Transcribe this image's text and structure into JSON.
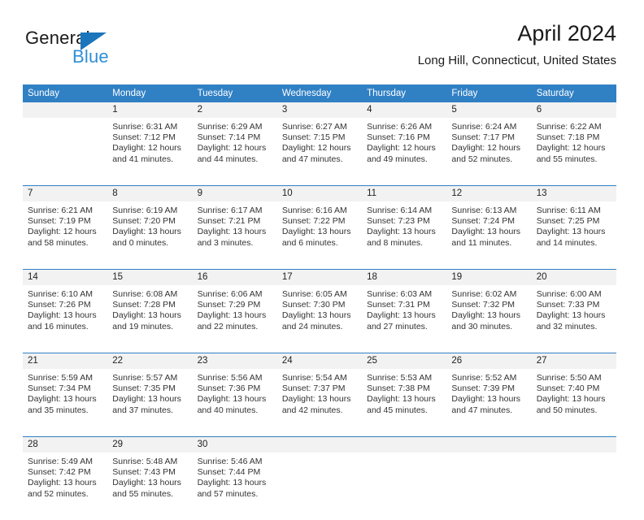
{
  "brand": {
    "name_top": "General",
    "name_bottom": "Blue",
    "triangle_color": "#1b75bb",
    "blue_color": "#2e8fd6"
  },
  "header": {
    "title": "April 2024",
    "location": "Long Hill, Connecticut, United States"
  },
  "theme": {
    "header_blue": "#3080c4",
    "daynum_band": "#f2f2f2",
    "text": "#333333"
  },
  "weekday_headers": [
    "Sunday",
    "Monday",
    "Tuesday",
    "Wednesday",
    "Thursday",
    "Friday",
    "Saturday"
  ],
  "labels": {
    "sunrise_prefix": "Sunrise:",
    "sunset_prefix": "Sunset:",
    "daylight_prefix": "Daylight:"
  },
  "weeks": [
    {
      "days": [
        {
          "num": "",
          "sunrise": "",
          "sunset": "",
          "daylight_1": "",
          "daylight_2": ""
        },
        {
          "num": "1",
          "sunrise": "Sunrise: 6:31 AM",
          "sunset": "Sunset: 7:12 PM",
          "daylight_1": "Daylight: 12 hours",
          "daylight_2": "and 41 minutes."
        },
        {
          "num": "2",
          "sunrise": "Sunrise: 6:29 AM",
          "sunset": "Sunset: 7:14 PM",
          "daylight_1": "Daylight: 12 hours",
          "daylight_2": "and 44 minutes."
        },
        {
          "num": "3",
          "sunrise": "Sunrise: 6:27 AM",
          "sunset": "Sunset: 7:15 PM",
          "daylight_1": "Daylight: 12 hours",
          "daylight_2": "and 47 minutes."
        },
        {
          "num": "4",
          "sunrise": "Sunrise: 6:26 AM",
          "sunset": "Sunset: 7:16 PM",
          "daylight_1": "Daylight: 12 hours",
          "daylight_2": "and 49 minutes."
        },
        {
          "num": "5",
          "sunrise": "Sunrise: 6:24 AM",
          "sunset": "Sunset: 7:17 PM",
          "daylight_1": "Daylight: 12 hours",
          "daylight_2": "and 52 minutes."
        },
        {
          "num": "6",
          "sunrise": "Sunrise: 6:22 AM",
          "sunset": "Sunset: 7:18 PM",
          "daylight_1": "Daylight: 12 hours",
          "daylight_2": "and 55 minutes."
        }
      ]
    },
    {
      "days": [
        {
          "num": "7",
          "sunrise": "Sunrise: 6:21 AM",
          "sunset": "Sunset: 7:19 PM",
          "daylight_1": "Daylight: 12 hours",
          "daylight_2": "and 58 minutes."
        },
        {
          "num": "8",
          "sunrise": "Sunrise: 6:19 AM",
          "sunset": "Sunset: 7:20 PM",
          "daylight_1": "Daylight: 13 hours",
          "daylight_2": "and 0 minutes."
        },
        {
          "num": "9",
          "sunrise": "Sunrise: 6:17 AM",
          "sunset": "Sunset: 7:21 PM",
          "daylight_1": "Daylight: 13 hours",
          "daylight_2": "and 3 minutes."
        },
        {
          "num": "10",
          "sunrise": "Sunrise: 6:16 AM",
          "sunset": "Sunset: 7:22 PM",
          "daylight_1": "Daylight: 13 hours",
          "daylight_2": "and 6 minutes."
        },
        {
          "num": "11",
          "sunrise": "Sunrise: 6:14 AM",
          "sunset": "Sunset: 7:23 PM",
          "daylight_1": "Daylight: 13 hours",
          "daylight_2": "and 8 minutes."
        },
        {
          "num": "12",
          "sunrise": "Sunrise: 6:13 AM",
          "sunset": "Sunset: 7:24 PM",
          "daylight_1": "Daylight: 13 hours",
          "daylight_2": "and 11 minutes."
        },
        {
          "num": "13",
          "sunrise": "Sunrise: 6:11 AM",
          "sunset": "Sunset: 7:25 PM",
          "daylight_1": "Daylight: 13 hours",
          "daylight_2": "and 14 minutes."
        }
      ]
    },
    {
      "days": [
        {
          "num": "14",
          "sunrise": "Sunrise: 6:10 AM",
          "sunset": "Sunset: 7:26 PM",
          "daylight_1": "Daylight: 13 hours",
          "daylight_2": "and 16 minutes."
        },
        {
          "num": "15",
          "sunrise": "Sunrise: 6:08 AM",
          "sunset": "Sunset: 7:28 PM",
          "daylight_1": "Daylight: 13 hours",
          "daylight_2": "and 19 minutes."
        },
        {
          "num": "16",
          "sunrise": "Sunrise: 6:06 AM",
          "sunset": "Sunset: 7:29 PM",
          "daylight_1": "Daylight: 13 hours",
          "daylight_2": "and 22 minutes."
        },
        {
          "num": "17",
          "sunrise": "Sunrise: 6:05 AM",
          "sunset": "Sunset: 7:30 PM",
          "daylight_1": "Daylight: 13 hours",
          "daylight_2": "and 24 minutes."
        },
        {
          "num": "18",
          "sunrise": "Sunrise: 6:03 AM",
          "sunset": "Sunset: 7:31 PM",
          "daylight_1": "Daylight: 13 hours",
          "daylight_2": "and 27 minutes."
        },
        {
          "num": "19",
          "sunrise": "Sunrise: 6:02 AM",
          "sunset": "Sunset: 7:32 PM",
          "daylight_1": "Daylight: 13 hours",
          "daylight_2": "and 30 minutes."
        },
        {
          "num": "20",
          "sunrise": "Sunrise: 6:00 AM",
          "sunset": "Sunset: 7:33 PM",
          "daylight_1": "Daylight: 13 hours",
          "daylight_2": "and 32 minutes."
        }
      ]
    },
    {
      "days": [
        {
          "num": "21",
          "sunrise": "Sunrise: 5:59 AM",
          "sunset": "Sunset: 7:34 PM",
          "daylight_1": "Daylight: 13 hours",
          "daylight_2": "and 35 minutes."
        },
        {
          "num": "22",
          "sunrise": "Sunrise: 5:57 AM",
          "sunset": "Sunset: 7:35 PM",
          "daylight_1": "Daylight: 13 hours",
          "daylight_2": "and 37 minutes."
        },
        {
          "num": "23",
          "sunrise": "Sunrise: 5:56 AM",
          "sunset": "Sunset: 7:36 PM",
          "daylight_1": "Daylight: 13 hours",
          "daylight_2": "and 40 minutes."
        },
        {
          "num": "24",
          "sunrise": "Sunrise: 5:54 AM",
          "sunset": "Sunset: 7:37 PM",
          "daylight_1": "Daylight: 13 hours",
          "daylight_2": "and 42 minutes."
        },
        {
          "num": "25",
          "sunrise": "Sunrise: 5:53 AM",
          "sunset": "Sunset: 7:38 PM",
          "daylight_1": "Daylight: 13 hours",
          "daylight_2": "and 45 minutes."
        },
        {
          "num": "26",
          "sunrise": "Sunrise: 5:52 AM",
          "sunset": "Sunset: 7:39 PM",
          "daylight_1": "Daylight: 13 hours",
          "daylight_2": "and 47 minutes."
        },
        {
          "num": "27",
          "sunrise": "Sunrise: 5:50 AM",
          "sunset": "Sunset: 7:40 PM",
          "daylight_1": "Daylight: 13 hours",
          "daylight_2": "and 50 minutes."
        }
      ]
    },
    {
      "days": [
        {
          "num": "28",
          "sunrise": "Sunrise: 5:49 AM",
          "sunset": "Sunset: 7:42 PM",
          "daylight_1": "Daylight: 13 hours",
          "daylight_2": "and 52 minutes."
        },
        {
          "num": "29",
          "sunrise": "Sunrise: 5:48 AM",
          "sunset": "Sunset: 7:43 PM",
          "daylight_1": "Daylight: 13 hours",
          "daylight_2": "and 55 minutes."
        },
        {
          "num": "30",
          "sunrise": "Sunrise: 5:46 AM",
          "sunset": "Sunset: 7:44 PM",
          "daylight_1": "Daylight: 13 hours",
          "daylight_2": "and 57 minutes."
        },
        {
          "num": "",
          "sunrise": "",
          "sunset": "",
          "daylight_1": "",
          "daylight_2": ""
        },
        {
          "num": "",
          "sunrise": "",
          "sunset": "",
          "daylight_1": "",
          "daylight_2": ""
        },
        {
          "num": "",
          "sunrise": "",
          "sunset": "",
          "daylight_1": "",
          "daylight_2": ""
        },
        {
          "num": "",
          "sunrise": "",
          "sunset": "",
          "daylight_1": "",
          "daylight_2": ""
        }
      ]
    }
  ]
}
